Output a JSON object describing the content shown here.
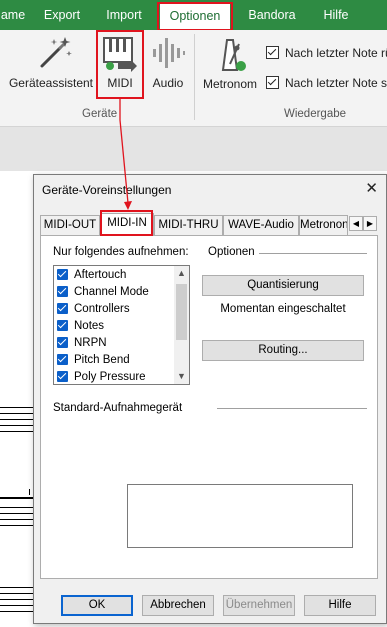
{
  "ribbon": {
    "tabs": [
      {
        "label": "ame"
      },
      {
        "label": "Export"
      },
      {
        "label": "Import"
      },
      {
        "label": "Optionen"
      },
      {
        "label": "Bandora"
      },
      {
        "label": "Hilfe"
      }
    ],
    "geraete": {
      "assistant_label": "Geräteassistent",
      "midi_label": "MIDI",
      "audio_label": "Audio",
      "group_label": "Geräte"
    },
    "wiedergabe": {
      "metronom_label": "Metronom",
      "check1": "Nach letzter Note rü",
      "check2": "Nach letzter Note sto",
      "group_label": "Wiedergabe"
    }
  },
  "dialog": {
    "title": "Geräte-Voreinstellungen",
    "close_glyph": "✕",
    "tabs": [
      "MIDI-OUT",
      "MIDI-IN",
      "MIDI-THRU",
      "WAVE-Audio",
      "Metronon"
    ],
    "scroll_left": "◀",
    "scroll_right": "▶",
    "record_label": "Nur folgendes aufnehmen:",
    "record_items": [
      "Aftertouch",
      "Channel Mode",
      "Controllers",
      "Notes",
      "NRPN",
      "Pitch Bend",
      "Poly Pressure"
    ],
    "options_label": "Optionen",
    "quantize_button": "Quantisierung",
    "status_text": "Momentan eingeschaltet",
    "routing_button": "Routing...",
    "standard_label": "Standard-Aufnahmegerät",
    "buttons": {
      "ok": "OK",
      "cancel": "Abbrechen",
      "apply": "Übernehmen",
      "help": "Hilfe"
    }
  },
  "colors": {
    "ribbon_green": "#2e8b43",
    "highlight_red": "#e0141e",
    "check_blue": "#0b5fc9"
  }
}
